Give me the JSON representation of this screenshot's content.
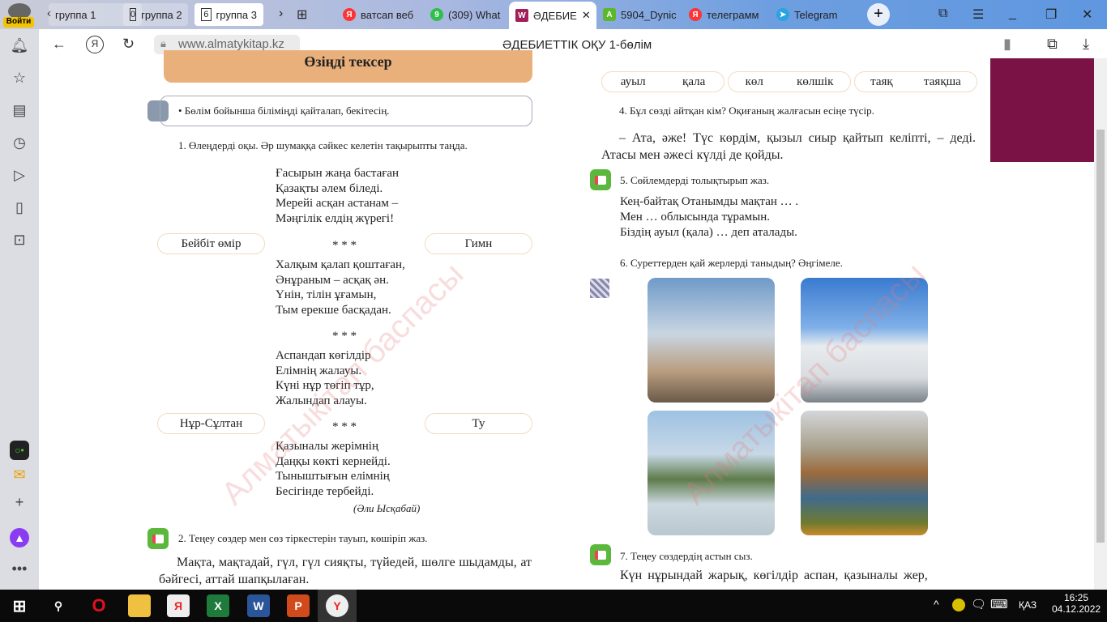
{
  "browser": {
    "login_label": "Войти",
    "tab_groups": [
      {
        "count": "",
        "label": "группа 1"
      },
      {
        "count": "0",
        "label": "группа 2"
      },
      {
        "count": "6",
        "label": "группа 3"
      }
    ],
    "tabs": [
      {
        "label": "ватсап веб",
        "icon": "yandex-icon",
        "color": "#f33"
      },
      {
        "label": "(309) What",
        "icon": "whatsapp-icon",
        "color": "#2ec04a"
      },
      {
        "label": "ӘДЕБИЕ",
        "icon": "book-icon",
        "color": "#a0205a",
        "active": true
      },
      {
        "label": "5904_Dynic",
        "icon": "app-icon",
        "color": "#5bb82a"
      },
      {
        "label": "телеграмм",
        "icon": "yandex-icon",
        "color": "#f33"
      },
      {
        "label": "Telegram",
        "icon": "telegram-icon",
        "color": "#2aa3e0"
      }
    ],
    "url": "www.almatykitap.kz",
    "page_title": "ӘДЕБИЕТТІК ОҚУ 1-бөлім"
  },
  "page": {
    "banner": "Өзіңді тексер",
    "goal": "• Бөлім бойынша біліміңді қайталап, бекітесің.",
    "task1": "1. Өлеңдерді оқы. Әр шумаққа сәйкес келетін тақырыпты таңда.",
    "stanza1": [
      "Ғасырын жаңа бастаған",
      "Қазақты әлем біледі.",
      "Мерейі асқан астанам –",
      "Мәңгілік елдің жүрегі!"
    ],
    "stars": "* * *",
    "stanza2": [
      "Халқым қалап қоштаған,",
      "Әнұраным – асқақ ән.",
      "Үнін, тілін ұғамын,",
      "Тым ерекше басқадан."
    ],
    "stanza3": [
      "Аспандап көгілдір",
      "Елімнің жалауы.",
      "Күні нұр төгіп тұр,",
      "Жалындап алауы."
    ],
    "stanza4": [
      "Қазыналы жерімнің",
      "Даңқы көкті кернейді.",
      "Тыныштығын елімнің",
      "Бесігінде тербейді."
    ],
    "author": "(Әли Ысқабай)",
    "topics": [
      "Бейбіт өмір",
      "Гимн",
      "Нұр-Сұлтан",
      "Ту"
    ],
    "task2": "2. Теңеу сөздер мен сөз тіркестерін тауып, көшіріп жаз.",
    "task2_text": "Мақта, мақтадай, гүл, гүл сияқты, түйедей, шөлге шыдамды, ат бәйгесі, аттай шапқылаған.",
    "word_pairs": [
      [
        "ауыл",
        "қала"
      ],
      [
        "көл",
        "көлшік"
      ],
      [
        "таяқ",
        "таяқша"
      ]
    ],
    "task4": "4. Бұл сөзді айтқан кім? Оқиғаның жалғасын есіңе түсір.",
    "task4_text": "– Ата, әже! Түс көрдім, қызыл сиыр қайтып келіпті, – деді. Атасы мен әжесі күлді де қойды.",
    "task5": "5. Сөйлемдерді толықтырып жаз.",
    "task5_lines": [
      "Кең-байтақ Отанымды мақтан … .",
      "Мен … облысында тұрамын.",
      "Біздің ауыл (қала) … деп аталады."
    ],
    "task6": "6. Суреттерден қай жерлерді таныдың? Әңгімеле.",
    "task7": "7. Теңеу сөздердің астын сыз.",
    "task7_text": "Күн нұрындай жарық, көгілдір аспан, қазыналы жер,",
    "watermark": "Алматыкітап баспасы"
  },
  "taskbar": {
    "language": "ҚАЗ",
    "time": "16:25",
    "date": "04.12.2022"
  }
}
